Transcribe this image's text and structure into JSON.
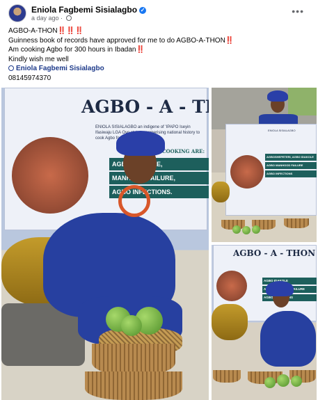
{
  "header": {
    "author": "Eniola Fagbemi Sisialagbo",
    "verified_icon": "verified-check-icon",
    "timestamp": "a day ago",
    "audience_icon": "globe-icon",
    "more_icon": "more-options-icon"
  },
  "post": {
    "line1": "AGBO-A-THON‼️‼️‼️",
    "line2": "Guinness book of records have approved for me to do AGBO-A-THON‼️",
    "line3": "Am cooking Agbo for 300 hours in Ibadan‼️",
    "line4": "Kindly wish me well",
    "mention": "Eniola Fagbemi Sisialagbo",
    "phone": "08145974370"
  },
  "photos": {
    "main": {
      "title": "AGBO - A - THON",
      "subtitle": "ENIOLA SISIALAGBO an indigene of 'IPAPO Iseyin Ifasiwaju LGA Oyo state, mesmerising national history to cook Agbo for 300 hours.",
      "cooking_are": "AGBO COOKING ARE:",
      "band1": "AGBO IDAKOLE,",
      "band2": "MANHOOD FAILURE,",
      "band3": "AGBO INFECTIONS."
    },
    "top_right": {
      "band1": "AGBOSHEPETERI, AGBO IDAKOLE",
      "band2": "AGBO MANHOOD FAILURE",
      "band3": "AGBO INFECTIONS"
    },
    "bottom_right": {
      "title": "AGBO - A - THON",
      "band1": "AGBO IDAKOLE",
      "band2": "AGBO MANHOOD FAILURE",
      "band3": "AGBO INFECTIONS"
    }
  }
}
